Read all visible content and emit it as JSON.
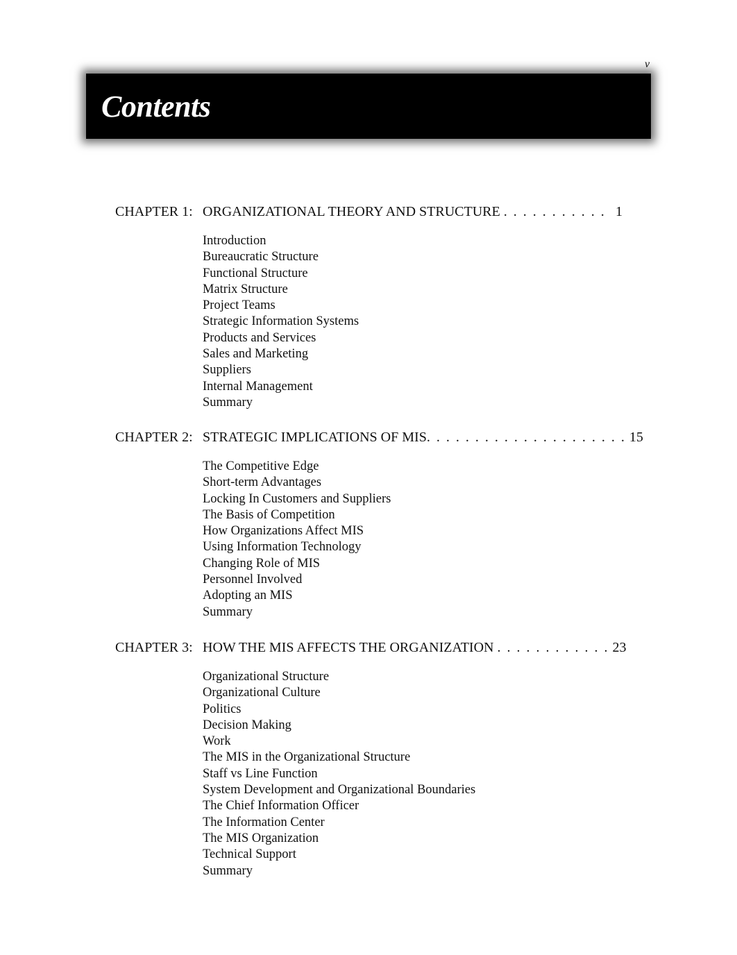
{
  "page": {
    "number": "v",
    "title": "Contents"
  },
  "chapters": [
    {
      "label": "CHAPTER 1:",
      "title": "ORGANIZATIONAL THEORY AND STRUCTURE",
      "leader": ". . . . . . . . . . .",
      "page": "1",
      "sections": [
        "Introduction",
        "Bureaucratic Structure",
        "Functional Structure",
        "Matrix Structure",
        "Project Teams",
        "Strategic Information Systems",
        "Products and Services",
        "Sales and Marketing",
        "Suppliers",
        "Internal Management",
        "Summary"
      ]
    },
    {
      "label": "CHAPTER 2:",
      "title": "STRATEGIC IMPLICATIONS OF MIS",
      "leader": ". . . . . . . . . . . . . . . . . . . . .",
      "page": "15",
      "sections": [
        "The Competitive Edge",
        "Short-term Advantages",
        "Locking In Customers and Suppliers",
        "The Basis of Competition",
        "How Organizations Affect MIS",
        "Using Information Technology",
        "Changing Role of MIS",
        "Personnel Involved",
        "Adopting an MIS",
        "Summary"
      ]
    },
    {
      "label": "CHAPTER 3:",
      "title": "HOW THE MIS AFFECTS THE ORGANIZATION",
      "leader": ". . . . . . . . . . . .",
      "page": "23",
      "sections": [
        "Organizational Structure",
        "Organizational Culture",
        "Politics",
        "Decision Making",
        "Work",
        "The MIS in the Organizational Structure",
        "Staff vs Line Function",
        "System Development and Organizational Boundaries",
        "The Chief Information Officer",
        "The Information Center",
        "The MIS Organization",
        "Technical Support",
        "Summary"
      ]
    }
  ]
}
